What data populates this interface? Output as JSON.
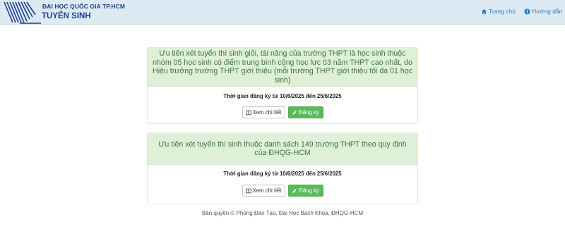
{
  "header": {
    "brand_top": "ĐẠI HỌC QUỐC GIA TP.HCM",
    "brand_main": "TUYỂN SINH",
    "nav": [
      {
        "label": "Trang chủ",
        "icon": "home-icon"
      },
      {
        "label": "Hướng dẫn",
        "icon": "info-icon"
      }
    ]
  },
  "programs": [
    {
      "title": "Ưu tiên xét tuyển thí sinh giỏi, tài năng của trường THPT là học sinh thuộc nhóm 05 học sinh có điểm trung bình cộng học lực 03 năm THPT cao nhất, do Hiệu trưởng trường THPT giới thiệu (mỗi trường THPT giới thiệu tối đa 01 học sinh)",
      "registration_time": "Thời gian đăng ký từ 10/6/2025 đến 25/6/2025",
      "detail_label": "Xem chi tiết",
      "register_label": "Đăng ký"
    },
    {
      "title": "Ưu tiên xét tuyển thí sinh thuộc danh sách 149 trường THPT theo quy định của ĐHQG-HCM",
      "registration_time": "Thời gian đăng ký từ 10/6/2025 đến 25/6/2025",
      "detail_label": "Xem chi tiết",
      "register_label": "Đăng ký"
    }
  ],
  "footer": {
    "copyright": "Bản quyền © Phòng Đào Tạo, Đại Học Bách Khoa, ĐHQG-HCM"
  },
  "colors": {
    "navbar_bg": "#ddeaf4",
    "brand": "#1b3f8f",
    "link": "#2a7bc0",
    "panel_heading_bg": "#dff0d8",
    "panel_heading_text": "#3c763d",
    "success": "#5cb85c"
  }
}
